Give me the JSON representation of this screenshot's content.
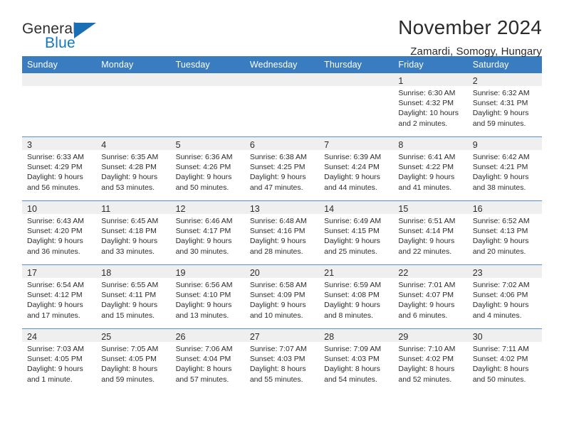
{
  "brand": {
    "name_top": "General",
    "name_bottom": "Blue",
    "triangle_color": "#1a6fb4",
    "text_color": "#2f2f2f",
    "accent_color": "#1278be"
  },
  "header": {
    "title": "November 2024",
    "subtitle": "Zamardi, Somogy, Hungary"
  },
  "theme": {
    "header_row_bg": "#3a7cc0",
    "header_row_text": "#ffffff",
    "daynum_band_bg": "#efefef",
    "cell_border": "#5b8fc7",
    "body_text": "#2b2b2b"
  },
  "weekdays": [
    "Sunday",
    "Monday",
    "Tuesday",
    "Wednesday",
    "Thursday",
    "Friday",
    "Saturday"
  ],
  "weeks": [
    [
      {
        "day": "",
        "empty": true,
        "lines": []
      },
      {
        "day": "",
        "empty": true,
        "lines": []
      },
      {
        "day": "",
        "empty": true,
        "lines": []
      },
      {
        "day": "",
        "empty": true,
        "lines": []
      },
      {
        "day": "",
        "empty": true,
        "lines": []
      },
      {
        "day": "1",
        "empty": false,
        "lines": [
          "Sunrise: 6:30 AM",
          "Sunset: 4:32 PM",
          "Daylight: 10 hours",
          "and 2 minutes."
        ]
      },
      {
        "day": "2",
        "empty": false,
        "lines": [
          "Sunrise: 6:32 AM",
          "Sunset: 4:31 PM",
          "Daylight: 9 hours",
          "and 59 minutes."
        ]
      }
    ],
    [
      {
        "day": "3",
        "empty": false,
        "lines": [
          "Sunrise: 6:33 AM",
          "Sunset: 4:29 PM",
          "Daylight: 9 hours",
          "and 56 minutes."
        ]
      },
      {
        "day": "4",
        "empty": false,
        "lines": [
          "Sunrise: 6:35 AM",
          "Sunset: 4:28 PM",
          "Daylight: 9 hours",
          "and 53 minutes."
        ]
      },
      {
        "day": "5",
        "empty": false,
        "lines": [
          "Sunrise: 6:36 AM",
          "Sunset: 4:26 PM",
          "Daylight: 9 hours",
          "and 50 minutes."
        ]
      },
      {
        "day": "6",
        "empty": false,
        "lines": [
          "Sunrise: 6:38 AM",
          "Sunset: 4:25 PM",
          "Daylight: 9 hours",
          "and 47 minutes."
        ]
      },
      {
        "day": "7",
        "empty": false,
        "lines": [
          "Sunrise: 6:39 AM",
          "Sunset: 4:24 PM",
          "Daylight: 9 hours",
          "and 44 minutes."
        ]
      },
      {
        "day": "8",
        "empty": false,
        "lines": [
          "Sunrise: 6:41 AM",
          "Sunset: 4:22 PM",
          "Daylight: 9 hours",
          "and 41 minutes."
        ]
      },
      {
        "day": "9",
        "empty": false,
        "lines": [
          "Sunrise: 6:42 AM",
          "Sunset: 4:21 PM",
          "Daylight: 9 hours",
          "and 38 minutes."
        ]
      }
    ],
    [
      {
        "day": "10",
        "empty": false,
        "lines": [
          "Sunrise: 6:43 AM",
          "Sunset: 4:20 PM",
          "Daylight: 9 hours",
          "and 36 minutes."
        ]
      },
      {
        "day": "11",
        "empty": false,
        "lines": [
          "Sunrise: 6:45 AM",
          "Sunset: 4:18 PM",
          "Daylight: 9 hours",
          "and 33 minutes."
        ]
      },
      {
        "day": "12",
        "empty": false,
        "lines": [
          "Sunrise: 6:46 AM",
          "Sunset: 4:17 PM",
          "Daylight: 9 hours",
          "and 30 minutes."
        ]
      },
      {
        "day": "13",
        "empty": false,
        "lines": [
          "Sunrise: 6:48 AM",
          "Sunset: 4:16 PM",
          "Daylight: 9 hours",
          "and 28 minutes."
        ]
      },
      {
        "day": "14",
        "empty": false,
        "lines": [
          "Sunrise: 6:49 AM",
          "Sunset: 4:15 PM",
          "Daylight: 9 hours",
          "and 25 minutes."
        ]
      },
      {
        "day": "15",
        "empty": false,
        "lines": [
          "Sunrise: 6:51 AM",
          "Sunset: 4:14 PM",
          "Daylight: 9 hours",
          "and 22 minutes."
        ]
      },
      {
        "day": "16",
        "empty": false,
        "lines": [
          "Sunrise: 6:52 AM",
          "Sunset: 4:13 PM",
          "Daylight: 9 hours",
          "and 20 minutes."
        ]
      }
    ],
    [
      {
        "day": "17",
        "empty": false,
        "lines": [
          "Sunrise: 6:54 AM",
          "Sunset: 4:12 PM",
          "Daylight: 9 hours",
          "and 17 minutes."
        ]
      },
      {
        "day": "18",
        "empty": false,
        "lines": [
          "Sunrise: 6:55 AM",
          "Sunset: 4:11 PM",
          "Daylight: 9 hours",
          "and 15 minutes."
        ]
      },
      {
        "day": "19",
        "empty": false,
        "lines": [
          "Sunrise: 6:56 AM",
          "Sunset: 4:10 PM",
          "Daylight: 9 hours",
          "and 13 minutes."
        ]
      },
      {
        "day": "20",
        "empty": false,
        "lines": [
          "Sunrise: 6:58 AM",
          "Sunset: 4:09 PM",
          "Daylight: 9 hours",
          "and 10 minutes."
        ]
      },
      {
        "day": "21",
        "empty": false,
        "lines": [
          "Sunrise: 6:59 AM",
          "Sunset: 4:08 PM",
          "Daylight: 9 hours",
          "and 8 minutes."
        ]
      },
      {
        "day": "22",
        "empty": false,
        "lines": [
          "Sunrise: 7:01 AM",
          "Sunset: 4:07 PM",
          "Daylight: 9 hours",
          "and 6 minutes."
        ]
      },
      {
        "day": "23",
        "empty": false,
        "lines": [
          "Sunrise: 7:02 AM",
          "Sunset: 4:06 PM",
          "Daylight: 9 hours",
          "and 4 minutes."
        ]
      }
    ],
    [
      {
        "day": "24",
        "empty": false,
        "lines": [
          "Sunrise: 7:03 AM",
          "Sunset: 4:05 PM",
          "Daylight: 9 hours",
          "and 1 minute."
        ]
      },
      {
        "day": "25",
        "empty": false,
        "lines": [
          "Sunrise: 7:05 AM",
          "Sunset: 4:05 PM",
          "Daylight: 8 hours",
          "and 59 minutes."
        ]
      },
      {
        "day": "26",
        "empty": false,
        "lines": [
          "Sunrise: 7:06 AM",
          "Sunset: 4:04 PM",
          "Daylight: 8 hours",
          "and 57 minutes."
        ]
      },
      {
        "day": "27",
        "empty": false,
        "lines": [
          "Sunrise: 7:07 AM",
          "Sunset: 4:03 PM",
          "Daylight: 8 hours",
          "and 55 minutes."
        ]
      },
      {
        "day": "28",
        "empty": false,
        "lines": [
          "Sunrise: 7:09 AM",
          "Sunset: 4:03 PM",
          "Daylight: 8 hours",
          "and 54 minutes."
        ]
      },
      {
        "day": "29",
        "empty": false,
        "lines": [
          "Sunrise: 7:10 AM",
          "Sunset: 4:02 PM",
          "Daylight: 8 hours",
          "and 52 minutes."
        ]
      },
      {
        "day": "30",
        "empty": false,
        "lines": [
          "Sunrise: 7:11 AM",
          "Sunset: 4:02 PM",
          "Daylight: 8 hours",
          "and 50 minutes."
        ]
      }
    ]
  ]
}
